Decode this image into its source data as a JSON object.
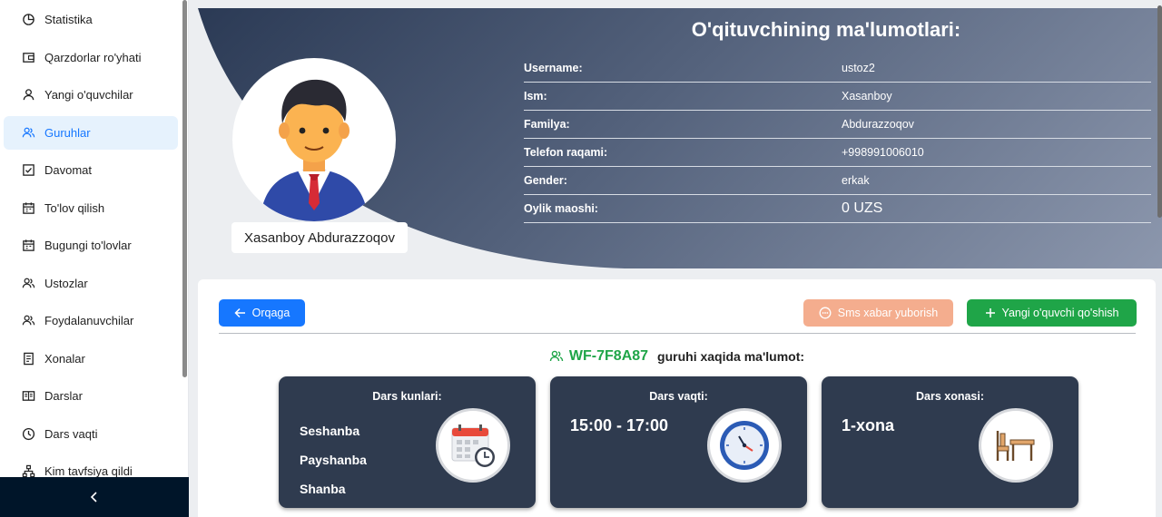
{
  "sidebar": {
    "items": [
      {
        "label": "Statistika",
        "icon": "pie-chart-icon"
      },
      {
        "label": "Qarzdorlar ro'yhati",
        "icon": "wallet-icon"
      },
      {
        "label": "Yangi o'quvchilar",
        "icon": "user-icon"
      },
      {
        "label": "Guruhlar",
        "icon": "team-icon",
        "active": true
      },
      {
        "label": "Davomat",
        "icon": "checkbox-icon"
      },
      {
        "label": "To'lov qilish",
        "icon": "calendar-icon"
      },
      {
        "label": "Bugungi to'lovlar",
        "icon": "calendar-icon"
      },
      {
        "label": "Ustozlar",
        "icon": "team-icon"
      },
      {
        "label": "Foydalanuvchilar",
        "icon": "team-icon"
      },
      {
        "label": "Xonalar",
        "icon": "file-icon"
      },
      {
        "label": "Darslar",
        "icon": "book-icon"
      },
      {
        "label": "Dars vaqti",
        "icon": "clock-icon"
      },
      {
        "label": "Kim tavfsiya qildi",
        "icon": "apartment-icon"
      }
    ],
    "collapse_icon": "chevron-left-icon"
  },
  "teacher": {
    "title": "O'qituvchining ma'lumotlari:",
    "full_name": "Xasanboy Abdurazzoqov",
    "fields": [
      {
        "key": "Username:",
        "value": "ustoz2"
      },
      {
        "key": "Ism:",
        "value": "Xasanboy"
      },
      {
        "key": "Familya:",
        "value": "Abdurazzoqov"
      },
      {
        "key": "Telefon raqami:",
        "value": "+998991006010"
      },
      {
        "key": "Gender:",
        "value": "erkak"
      },
      {
        "key": "Oylik maoshi:",
        "value": "0 UZS"
      }
    ]
  },
  "actions": {
    "back": "Orqaga",
    "sms": "Sms xabar yuborish",
    "add_student": "Yangi o'quvchi qo'shish"
  },
  "group": {
    "code": "WF-7F8A87",
    "suffix": "guruhi xaqida ma'lumot:"
  },
  "cards": {
    "days": {
      "title": "Dars kunlari:",
      "values": [
        "Seshanba",
        "Payshanba",
        "Shanba"
      ]
    },
    "time": {
      "title": "Dars vaqti:",
      "value": "15:00 - 17:00"
    },
    "room": {
      "title": "Dars xonasi:",
      "value": "1-xona"
    }
  },
  "colors": {
    "primary": "#1677ff",
    "success": "#1fa548",
    "warning": "#f4ad8e",
    "card": "#2f3b4f",
    "sidebar_dark": "#001529"
  }
}
